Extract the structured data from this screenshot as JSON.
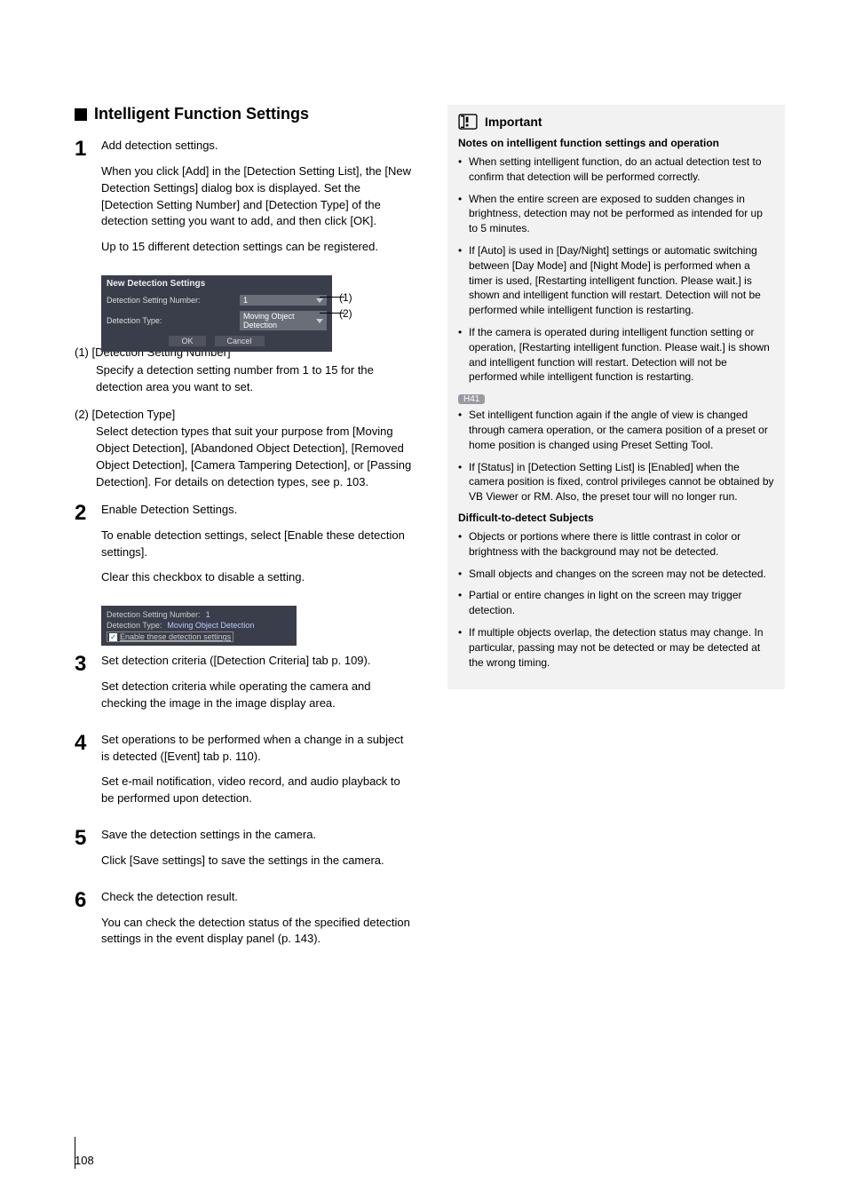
{
  "left": {
    "sectionTitle": "Intelligent Function Settings",
    "steps": [
      {
        "num": "1",
        "title": "Add detection settings.",
        "desc1": "When you click [Add] in the [Detection Setting List], the [New Detection Settings] dialog box is displayed. Set the [Detection Setting Number] and [Detection Type] of the detection setting you want to add, and then click [OK].",
        "desc2": "Up to 15 different detection settings can be registered."
      },
      {
        "num": "2",
        "title": "Enable Detection Settings.",
        "desc1": "To enable detection settings, select [Enable these detection settings].",
        "desc2": "Clear this checkbox to disable a setting."
      },
      {
        "num": "3",
        "title": "Set detection criteria ([Detection Criteria] tab p. 109).",
        "desc1": "Set detection criteria while operating the camera and checking the image in the image display area."
      },
      {
        "num": "4",
        "title": "Set operations to be performed when a change in a subject is detected ([Event] tab p. 110).",
        "desc1": "Set e-mail notification, video record, and audio playback to be performed upon detection."
      },
      {
        "num": "5",
        "title": "Save the detection settings in the camera.",
        "desc1": "Click [Save settings] to save the settings in the camera."
      },
      {
        "num": "6",
        "title": "Check the detection result.",
        "desc1": "You can check the detection status of the specified detection settings in the event display panel (p. 143)."
      }
    ],
    "dialog1": {
      "title": "New Detection Settings",
      "row1Label": "Detection Setting Number:",
      "row1Value": "1",
      "row2Label": "Detection Type:",
      "row2Value": "Moving Object Detection",
      "ok": "OK",
      "cancel": "Cancel",
      "callout1": "(1)",
      "callout2": "(2)"
    },
    "sub1": {
      "head": "(1) [Detection Setting Number]",
      "body": "Specify a detection setting number from 1 to 15 for the detection area you want to set."
    },
    "sub2": {
      "head": "(2) [Detection Type]",
      "body": "Select detection types that suit your purpose from [Moving Object Detection], [Abandoned Object Detection], [Removed Object Detection], [Camera Tampering Detection], or [Passing Detection]. For details on detection types, see p. 103."
    },
    "panel2": {
      "r1l": "Detection Setting Number:",
      "r1v": "1",
      "r2l": "Detection Type:",
      "r2v": "Moving Object Detection",
      "chk": "Enable these detection settings"
    }
  },
  "right": {
    "importantLabel": "Important",
    "notesHeading": "Notes on intelligent function settings and operation",
    "b1": "When setting intelligent function, do an actual detection test to confirm that detection will be performed correctly.",
    "b2": "When the entire screen are exposed to sudden changes in brightness, detection may not be performed as intended for up to 5 minutes.",
    "b3": "If [Auto] is used in [Day/Night] settings or automatic switching between [Day Mode] and [Night Mode] is performed when a timer is used, [Restarting intelligent function. Please wait.] is shown and intelligent function will restart. Detection will not be performed while intelligent function is restarting.",
    "b4": "If the camera is operated during intelligent function setting or operation, [Restarting intelligent function. Please wait.] is shown and intelligent function will restart. Detection will not be performed while intelligent function is restarting.",
    "modelTag": "H41",
    "b5": "Set intelligent function again if the angle of view is changed through camera operation, or the camera position of a preset or home position is changed using Preset Setting Tool.",
    "b6": "If [Status] in [Detection Setting List] is [Enabled] when the camera position is fixed, control privileges cannot be obtained by VB Viewer or RM. Also, the preset tour will no longer run.",
    "diffHeading": "Difficult-to-detect Subjects",
    "d1": "Objects or portions where there is little contrast in color or brightness with the background may not be detected.",
    "d2": "Small objects and changes on the screen may not be detected.",
    "d3": "Partial or entire changes in light on the screen may trigger detection.",
    "d4": "If multiple objects overlap, the detection status may change. In particular, passing may not be detected or may be detected at the wrong timing."
  },
  "pageNum": "108"
}
